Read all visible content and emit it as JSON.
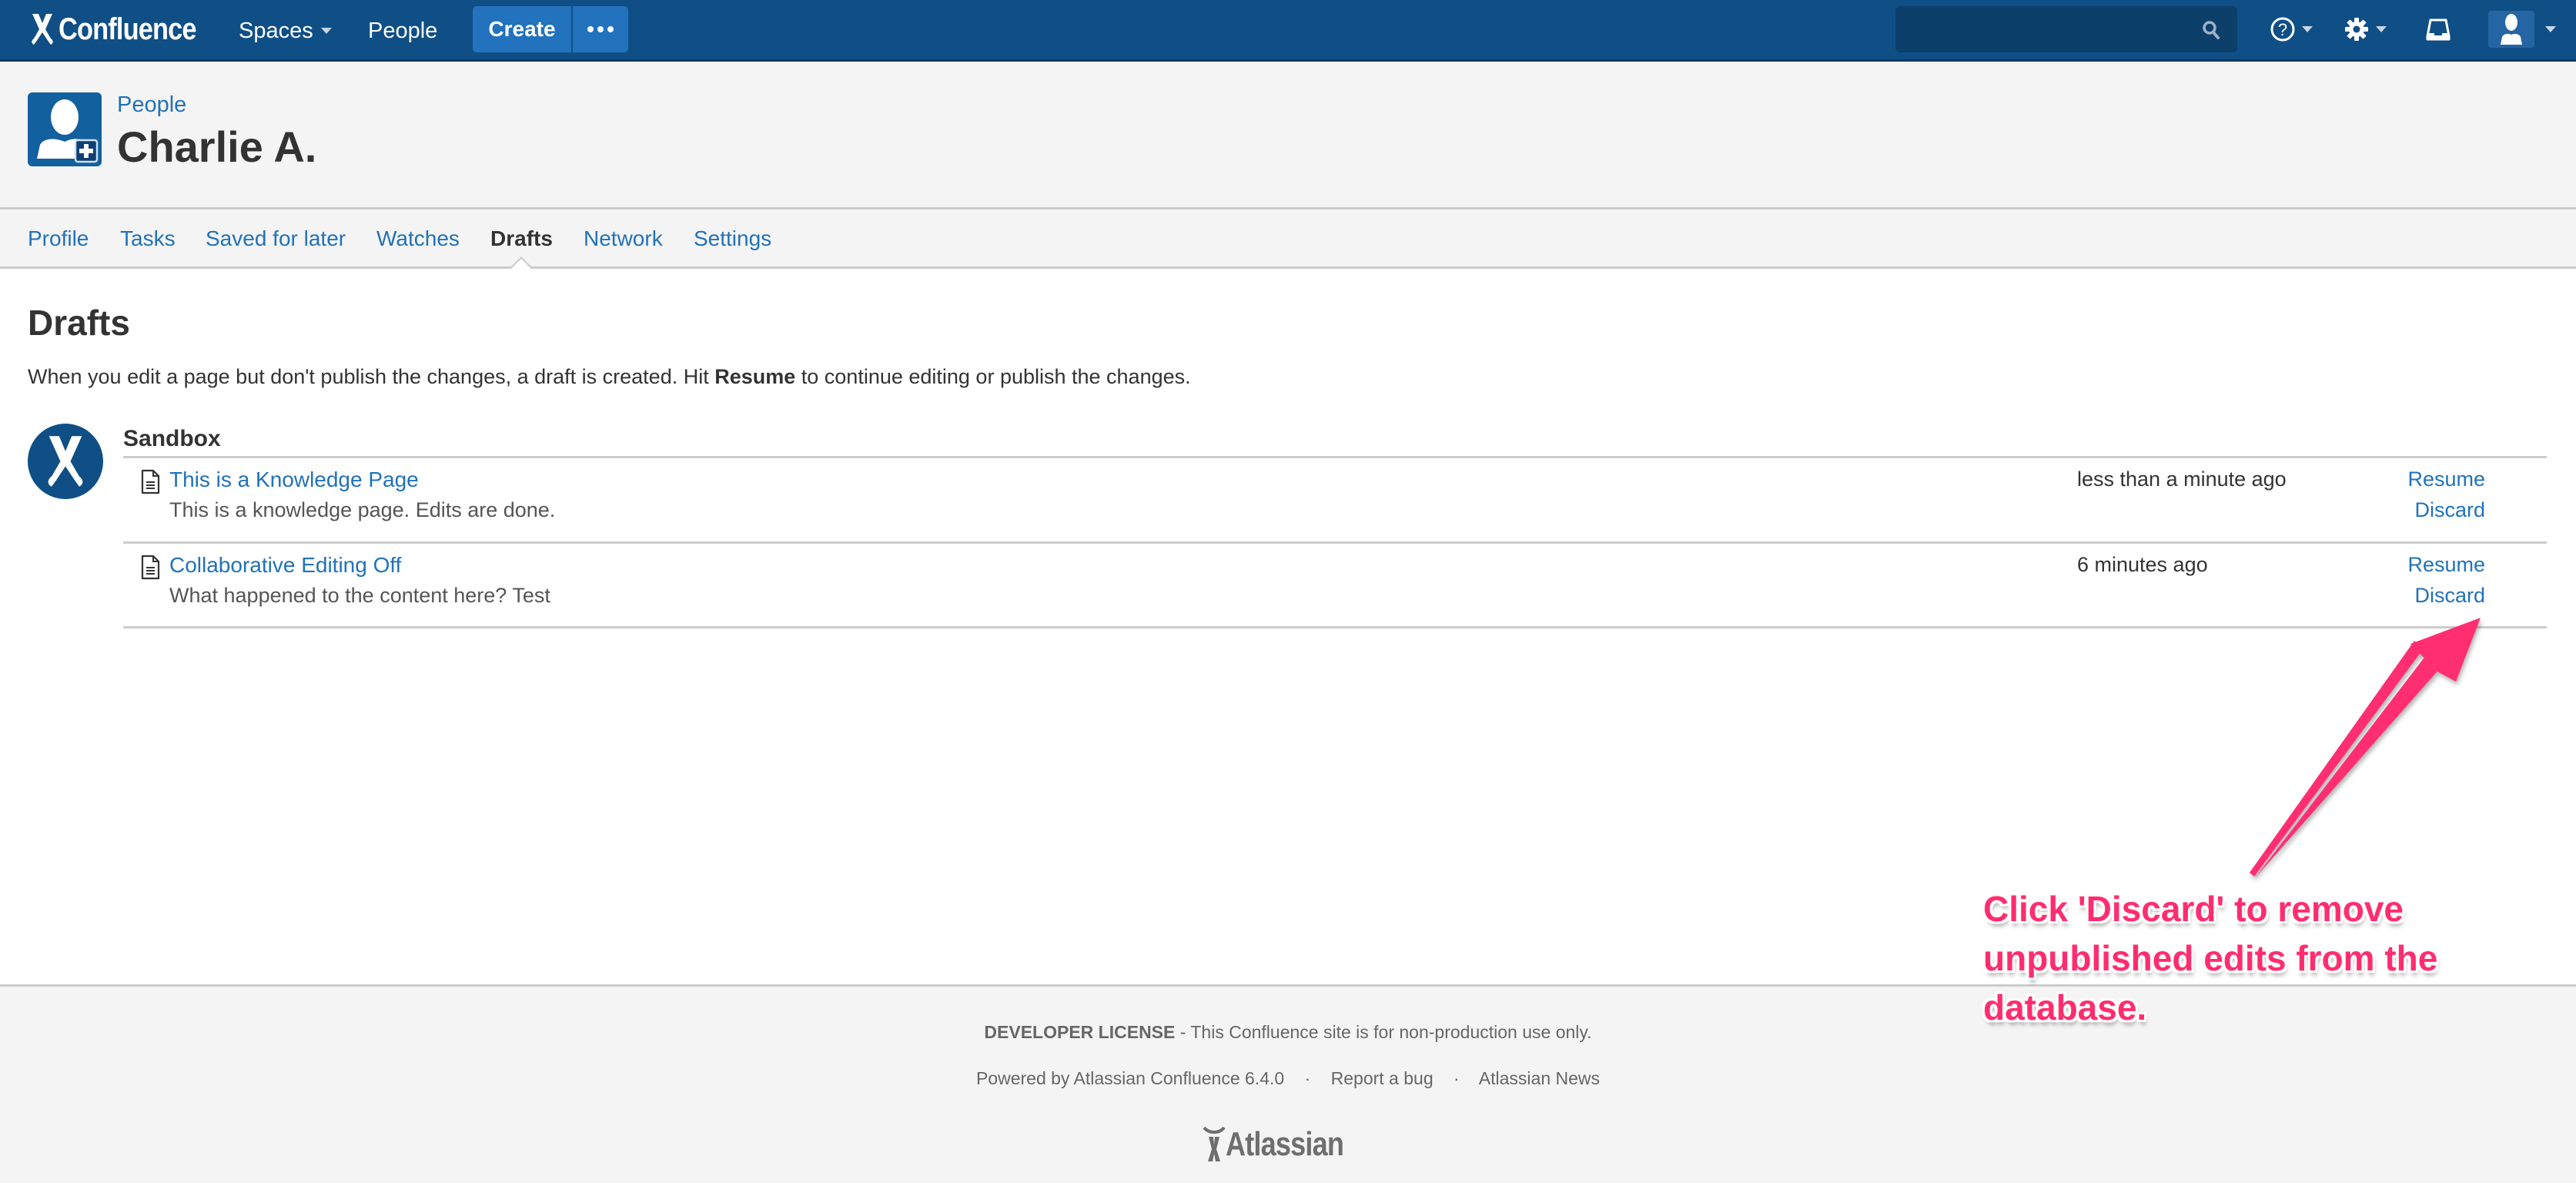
{
  "header": {
    "logo_text": "Confluence",
    "nav": [
      {
        "label": "Spaces",
        "has_dropdown": true
      },
      {
        "label": "People",
        "has_dropdown": false
      }
    ],
    "create_label": "Create",
    "more_icon": "ellipsis-icon",
    "search": {
      "value": "",
      "placeholder": "",
      "icon": "search-icon"
    },
    "icons": [
      "help-icon",
      "gear-icon",
      "inbox-icon",
      "user-avatar-icon"
    ]
  },
  "profile": {
    "breadcrumb": "People",
    "name": "Charlie A."
  },
  "tabs": [
    {
      "label": "Profile",
      "active": false
    },
    {
      "label": "Tasks",
      "active": false
    },
    {
      "label": "Saved for later",
      "active": false
    },
    {
      "label": "Watches",
      "active": false
    },
    {
      "label": "Drafts",
      "active": true
    },
    {
      "label": "Network",
      "active": false
    },
    {
      "label": "Settings",
      "active": false
    }
  ],
  "content": {
    "title": "Drafts",
    "intro_before": "When you edit a page but don't publish the changes, a draft is created. Hit ",
    "intro_bold": "Resume",
    "intro_after": " to continue editing or publish the changes.",
    "space": {
      "name": "Sandbox",
      "drafts": [
        {
          "title": "This is a Knowledge Page",
          "excerpt": "This is a knowledge page. Edits are done.",
          "time": "less than a minute ago",
          "resume_label": "Resume",
          "discard_label": "Discard"
        },
        {
          "title": "Collaborative Editing Off",
          "excerpt": "What happened to the content here? Test",
          "time": "6 minutes ago",
          "resume_label": "Resume",
          "discard_label": "Discard"
        }
      ]
    }
  },
  "footer": {
    "license_bold": "DEVELOPER LICENSE",
    "license_rest": " - This Confluence site is for non-production use only.",
    "powered_by": "Powered by Atlassian Confluence 6.4.0",
    "separator": "·",
    "report_bug": "Report a bug",
    "news": "Atlassian News",
    "logo_text": "Atlassian"
  },
  "annotation": {
    "text": "Click 'Discard' to remove unpublished edits from the database.",
    "color": "#ff2d6f"
  },
  "colors": {
    "header_bg": "#0f4f86",
    "link": "#2172b9",
    "button": "#2272bd"
  }
}
